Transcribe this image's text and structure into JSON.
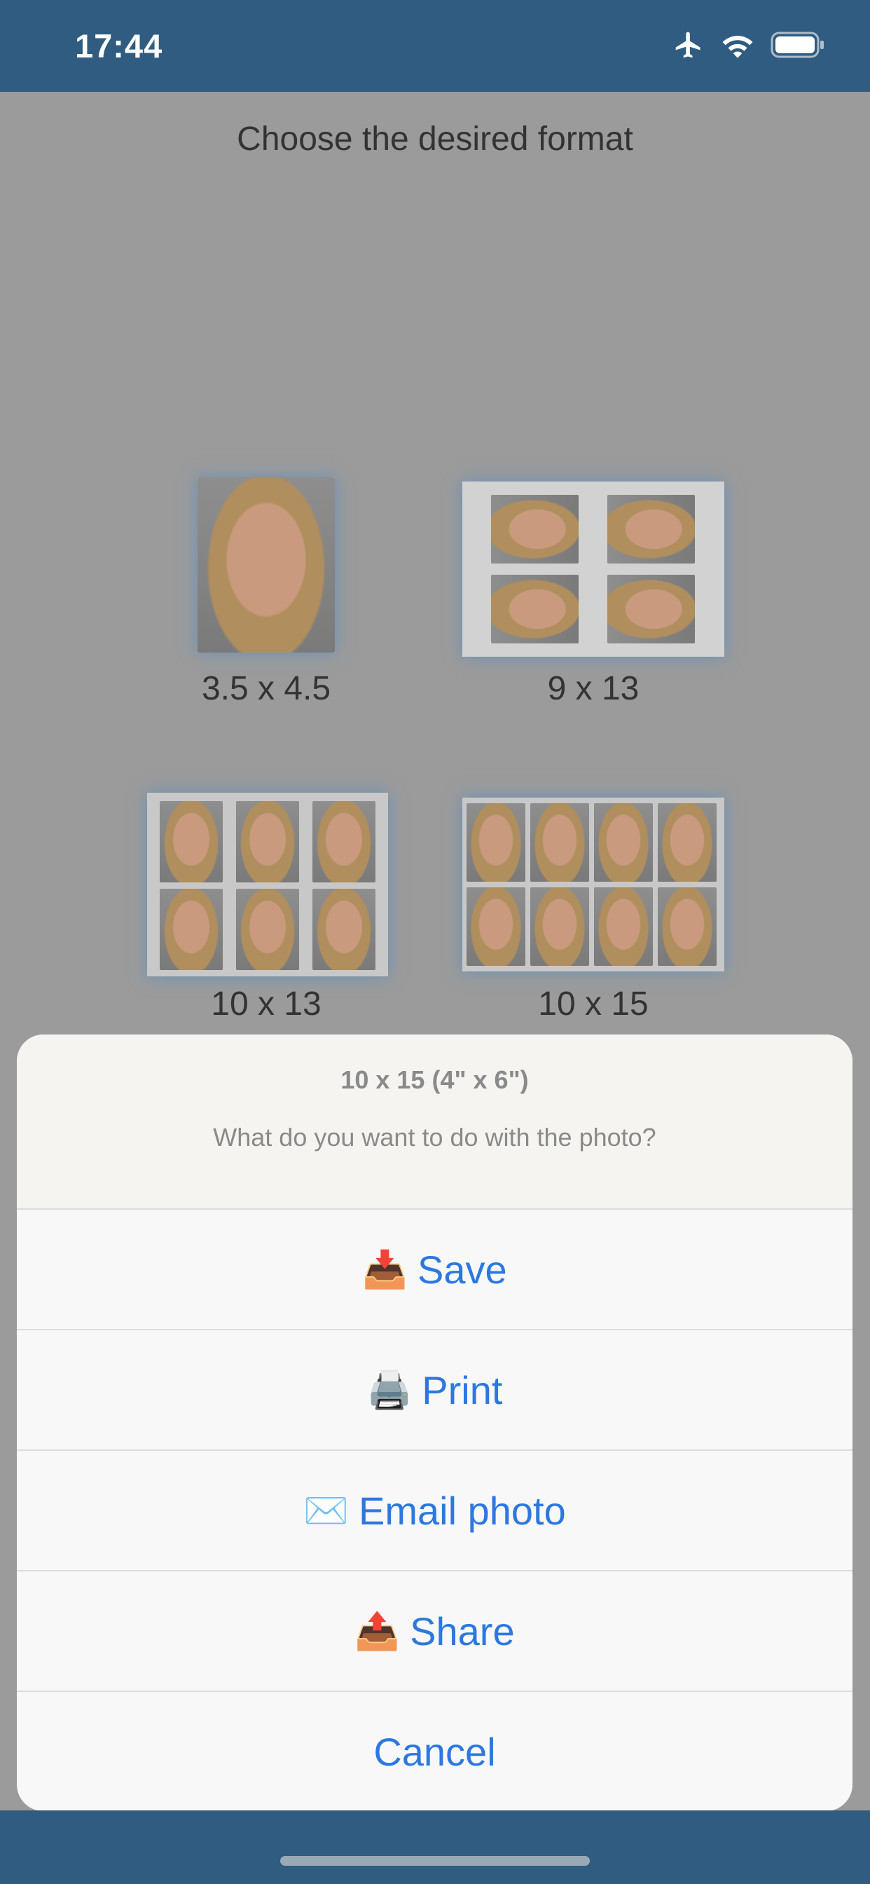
{
  "status_bar": {
    "time": "17:44"
  },
  "page": {
    "title": "Choose the desired format"
  },
  "formats": [
    {
      "label": "3.5 x 4.5"
    },
    {
      "label": "9 x 13"
    },
    {
      "label": "10 x 13"
    },
    {
      "label": "10 x 15"
    }
  ],
  "action_sheet": {
    "title": "10 x 15 (4\" x 6\")",
    "message": "What do you want to do with the photo?",
    "actions": [
      {
        "label": "Save",
        "emoji": "📥"
      },
      {
        "label": "Print",
        "emoji": "🖨️"
      },
      {
        "label": "Email photo",
        "emoji": "✉️"
      },
      {
        "label": "Share",
        "emoji": "📤"
      }
    ],
    "cancel_label": "Cancel"
  },
  "colors": {
    "accent": "#2c78e0",
    "bar": "#2f5c80",
    "backdrop": "#9b9b9b"
  }
}
